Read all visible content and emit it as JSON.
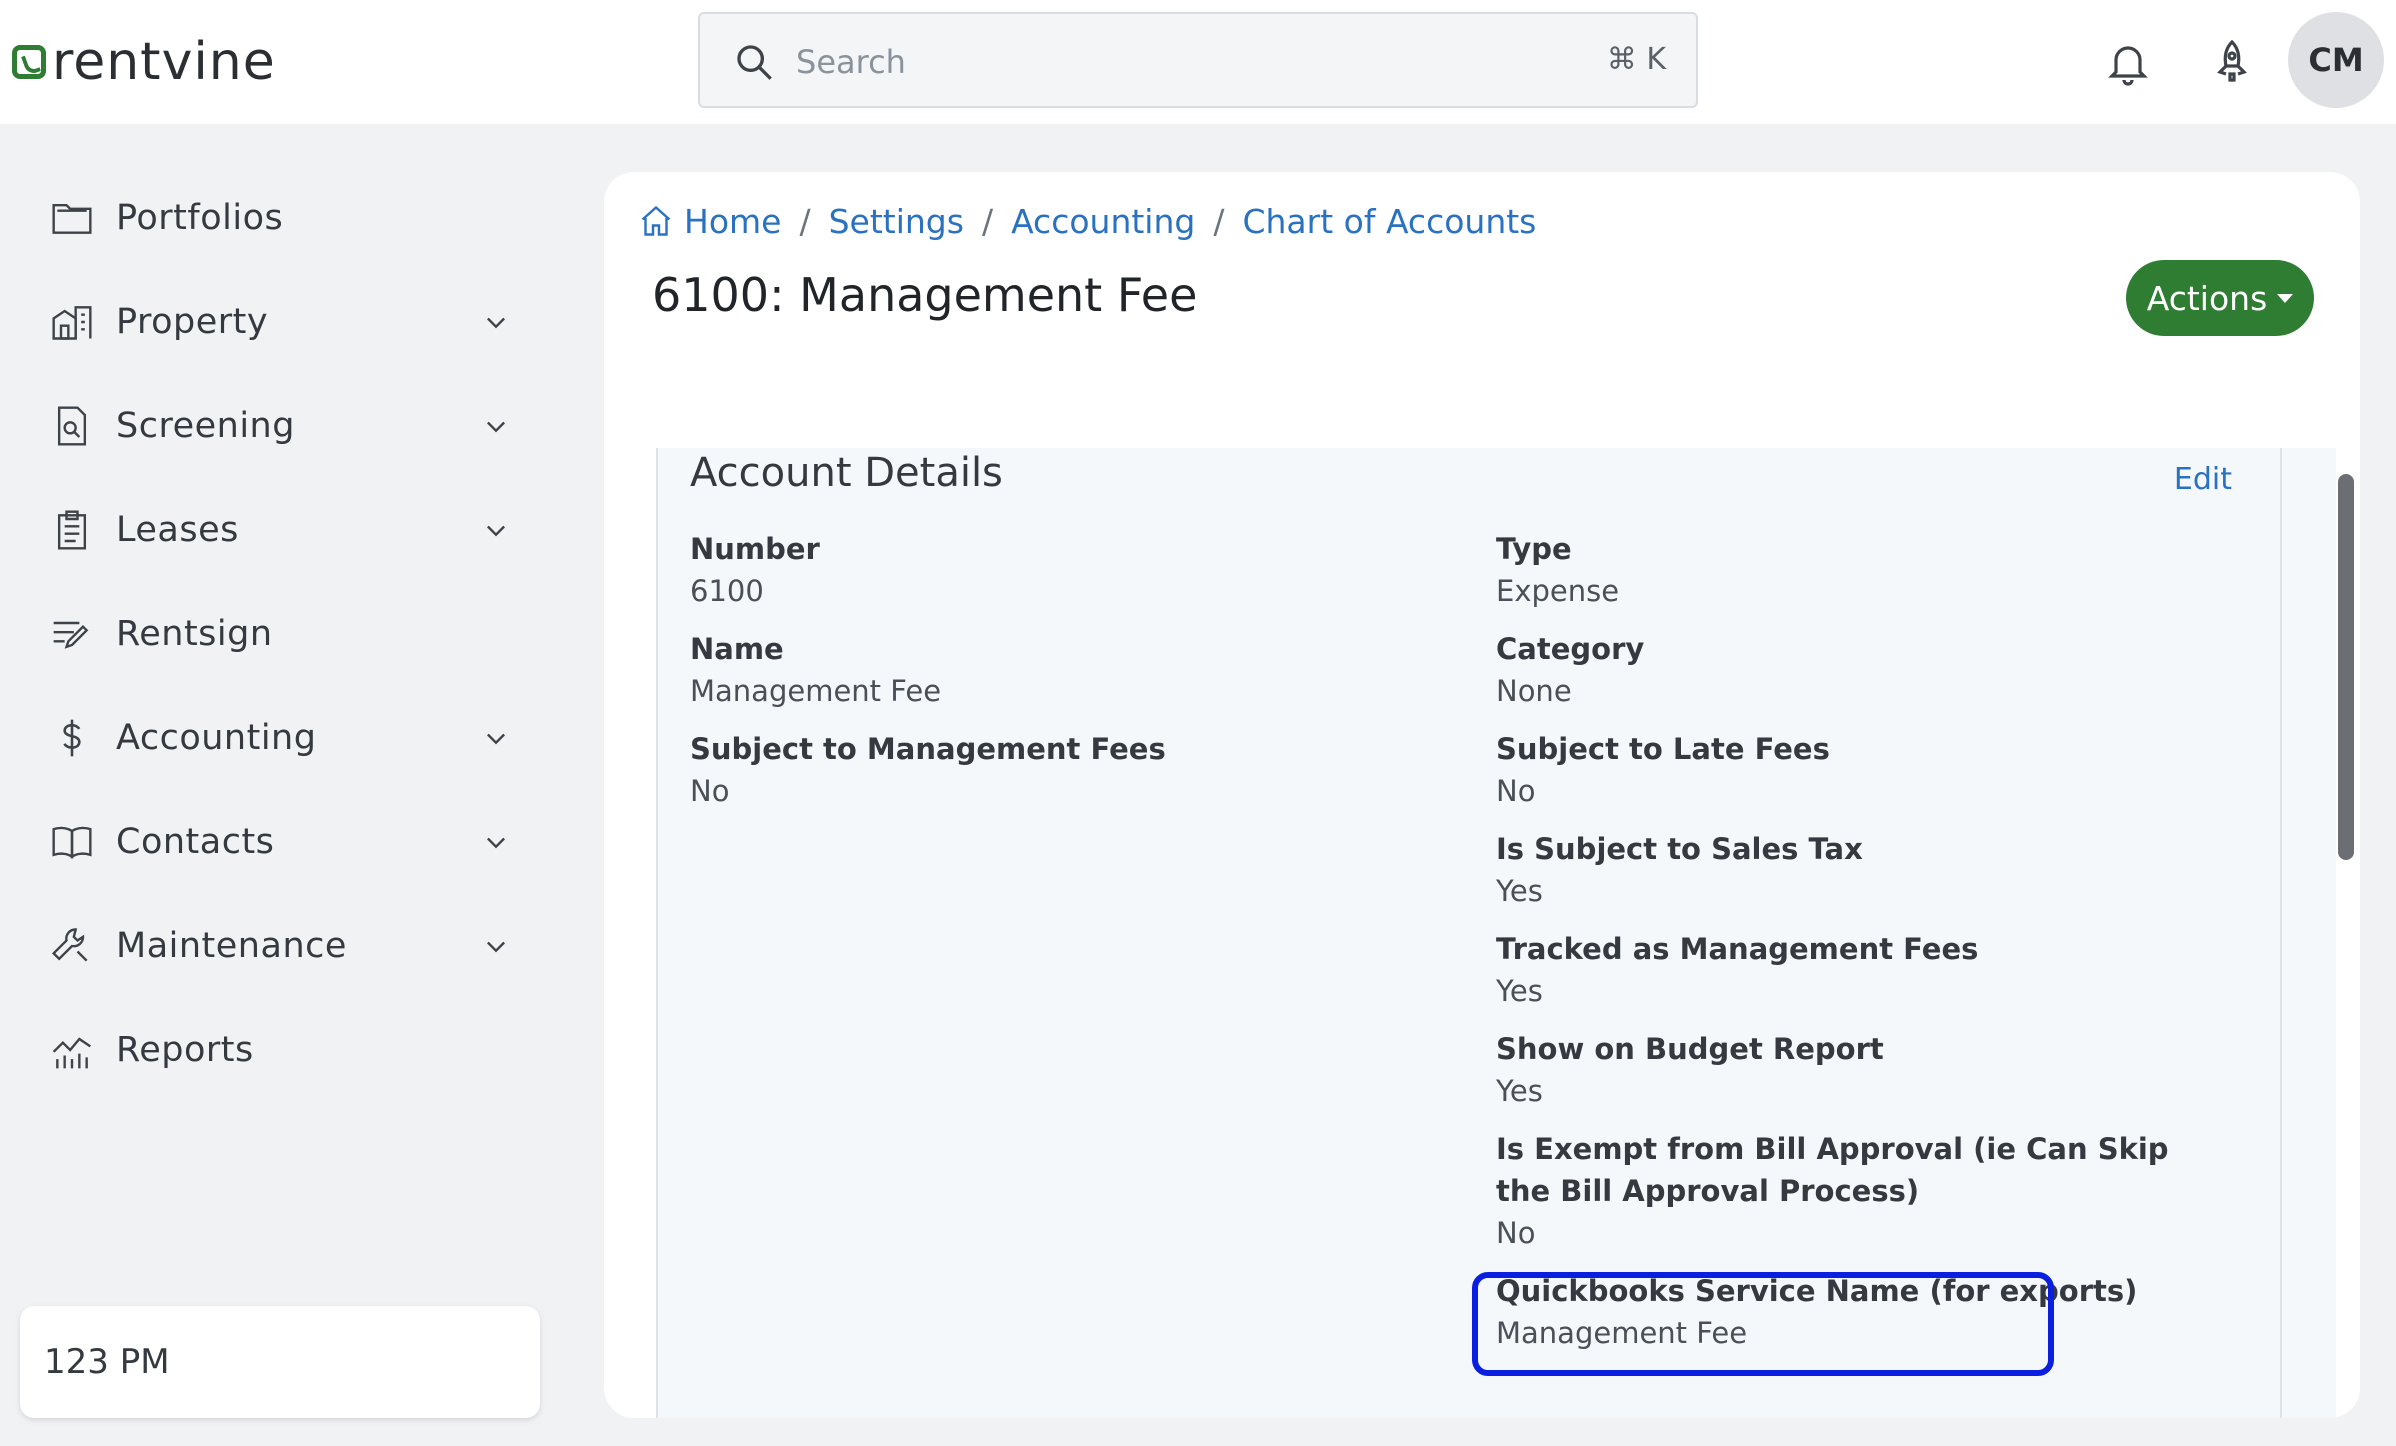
{
  "header": {
    "logo_text": "rentvine",
    "search": {
      "placeholder": "Search",
      "shortcut": "⌘ K"
    },
    "avatar_initials": "CM"
  },
  "sidebar": {
    "items": [
      {
        "label": "Portfolios",
        "icon": "folder-icon",
        "has_chevron": false
      },
      {
        "label": "Property",
        "icon": "building-icon",
        "has_chevron": true
      },
      {
        "label": "Screening",
        "icon": "document-search-icon",
        "has_chevron": true
      },
      {
        "label": "Leases",
        "icon": "clipboard-icon",
        "has_chevron": true
      },
      {
        "label": "Rentsign",
        "icon": "sign-pen-icon",
        "has_chevron": false
      },
      {
        "label": "Accounting",
        "icon": "dollar-icon",
        "has_chevron": true
      },
      {
        "label": "Contacts",
        "icon": "book-icon",
        "has_chevron": true
      },
      {
        "label": "Maintenance",
        "icon": "wrench-icon",
        "has_chevron": true
      },
      {
        "label": "Reports",
        "icon": "chart-icon",
        "has_chevron": false
      }
    ],
    "company": "123 PM"
  },
  "breadcrumb": {
    "items": [
      "Home",
      "Settings",
      "Accounting",
      "Chart of Accounts"
    ]
  },
  "page": {
    "title": "6100: Management Fee",
    "actions_label": "Actions"
  },
  "card": {
    "title": "Account Details",
    "edit_label": "Edit",
    "left_fields": [
      {
        "label": "Number",
        "value": "6100"
      },
      {
        "label": "Name",
        "value": "Management Fee"
      },
      {
        "label": "Subject to Management Fees",
        "value": "No"
      }
    ],
    "right_fields": [
      {
        "label": "Type",
        "value": "Expense"
      },
      {
        "label": "Category",
        "value": "None"
      },
      {
        "label": "Subject to Late Fees",
        "value": "No"
      },
      {
        "label": "Is Subject to Sales Tax",
        "value": "Yes"
      },
      {
        "label": "Tracked as Management Fees",
        "value": "Yes"
      },
      {
        "label": "Show on Budget Report",
        "value": "Yes"
      },
      {
        "label": "Is Exempt from Bill Approval (ie Can Skip the Bill Approval Process)",
        "value": "No"
      },
      {
        "label": "Quickbooks Service Name (for exports)",
        "value": "Management Fee"
      }
    ]
  },
  "colors": {
    "accent_green": "#2e7d32",
    "link_blue": "#2a72c1",
    "highlight_blue": "#0a1fe0"
  }
}
